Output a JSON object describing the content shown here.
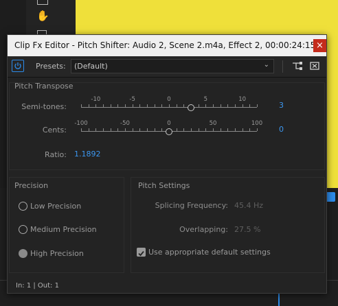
{
  "window": {
    "title": "Clip Fx Editor - Pitch Shifter: Audio 2, Scene 2.m4a, Effect 2, 00:00:24:15",
    "close_label": "×"
  },
  "toolbar": {
    "presets_label": "Presets:",
    "presets_value": "(Default)"
  },
  "pitch_transpose": {
    "title": "Pitch Transpose",
    "semitones": {
      "label": "Semi-tones:",
      "value": "3",
      "ticks": [
        "-10",
        "-5",
        "0",
        "5",
        "10"
      ],
      "min": -12,
      "max": 12,
      "current": 3
    },
    "cents": {
      "label": "Cents:",
      "value": "0",
      "ticks": [
        "-100",
        "-50",
        "0",
        "50",
        "100"
      ],
      "min": -100,
      "max": 100,
      "current": 0
    },
    "ratio": {
      "label": "Ratio:",
      "value": "1.1892"
    }
  },
  "precision": {
    "title": "Precision",
    "options": [
      {
        "label": "Low Precision",
        "selected": false
      },
      {
        "label": "Medium Precision",
        "selected": false
      },
      {
        "label": "High Precision",
        "selected": true
      }
    ]
  },
  "pitch_settings": {
    "title": "Pitch Settings",
    "splicing_label": "Splicing Frequency:",
    "splicing_value": "45.4 Hz",
    "overlapping_label": "Overlapping:",
    "overlapping_value": "27.5 %",
    "default_checkbox_label": "Use appropriate default settings",
    "default_checked": true
  },
  "status": {
    "text": "In: 1 | Out: 1"
  },
  "colors": {
    "accent": "#2d8ceb",
    "value_blue": "#3c97f0",
    "bg_yellow": "#efe03a",
    "close_red": "#c42b1c"
  }
}
